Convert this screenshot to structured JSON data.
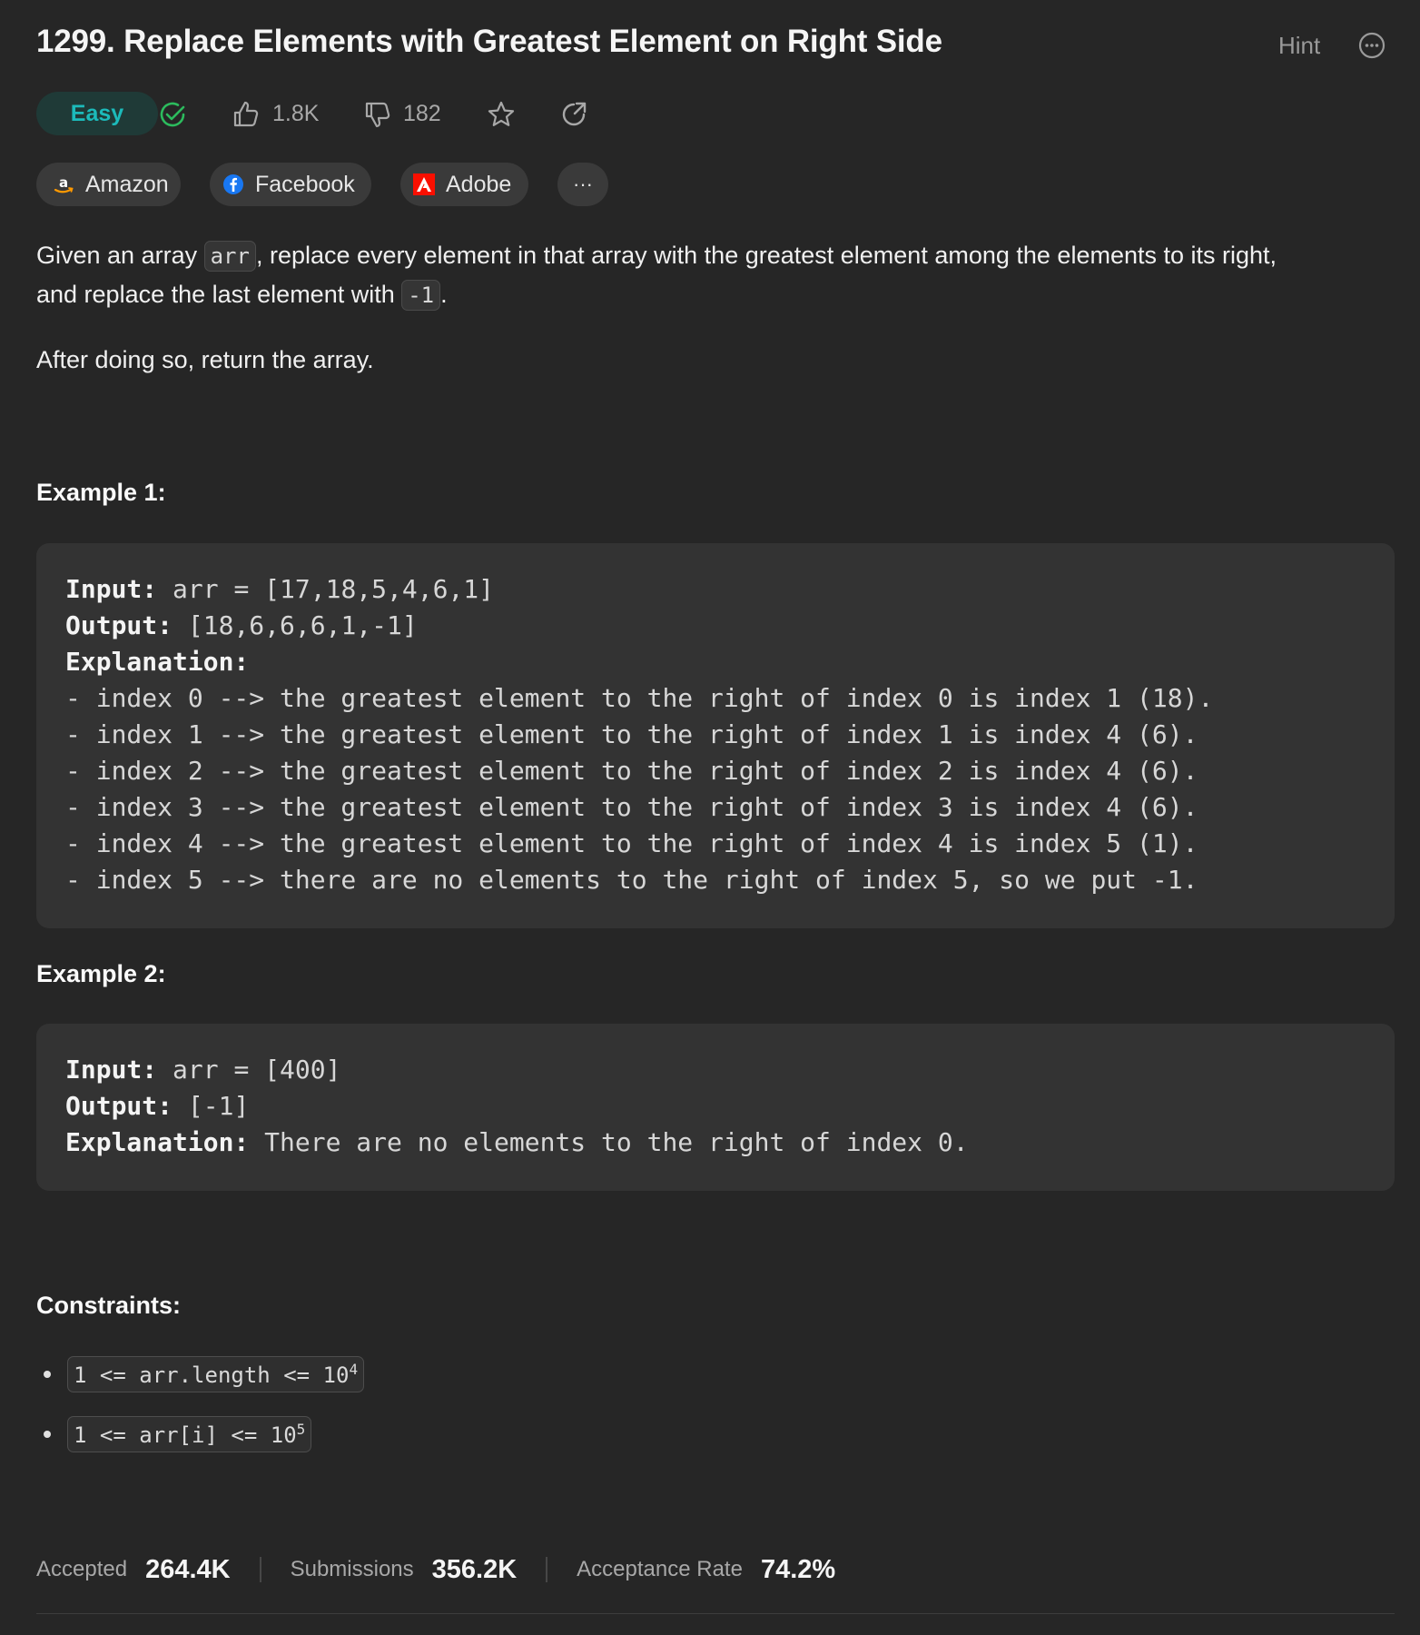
{
  "problem": {
    "title": "1299. Replace Elements with Greatest Element on Right Side",
    "hint_label": "Hint",
    "difficulty": "Easy",
    "likes": "1.8K",
    "dislikes": "182"
  },
  "tags": [
    {
      "label": "Amazon",
      "icon": "amazon-icon"
    },
    {
      "label": "Facebook",
      "icon": "facebook-icon"
    },
    {
      "label": "Adobe",
      "icon": "adobe-icon"
    }
  ],
  "more_tags_label": "···",
  "description": {
    "p1_a": "Given an array ",
    "p1_code1": "arr",
    "p1_b": ", replace every element in that array with the greatest element among the elements to its right,",
    "p1_c": "and replace the last element with ",
    "p1_code2": "-1",
    "p1_d": ".",
    "p2": "After doing so, return the array."
  },
  "examples": [
    {
      "heading": "Example 1:",
      "input_label": "Input:",
      "input": " arr = [17,18,5,4,6,1]",
      "output_label": "Output:",
      "output": " [18,6,6,6,1,-1]",
      "explanation_label": "Explanation:",
      "explanation_lines": [
        "- index 0 --> the greatest element to the right of index 0 is index 1 (18).",
        "- index 1 --> the greatest element to the right of index 1 is index 4 (6).",
        "- index 2 --> the greatest element to the right of index 2 is index 4 (6).",
        "- index 3 --> the greatest element to the right of index 3 is index 4 (6).",
        "- index 4 --> the greatest element to the right of index 4 is index 5 (1).",
        "- index 5 --> there are no elements to the right of index 5, so we put -1."
      ]
    },
    {
      "heading": "Example 2:",
      "input_label": "Input:",
      "input": " arr = [400]",
      "output_label": "Output:",
      "output": " [-1]",
      "explanation_label": "Explanation:",
      "explanation": " There are no elements to the right of index 0."
    }
  ],
  "constraints": {
    "heading": "Constraints:",
    "items": [
      {
        "text": "1 <= arr.length <= 10",
        "sup": "4"
      },
      {
        "text": "1 <= arr[i] <= 10",
        "sup": "5"
      }
    ]
  },
  "stats": {
    "accepted_label": "Accepted",
    "accepted": "264.4K",
    "submissions_label": "Submissions",
    "submissions": "356.2K",
    "rate_label": "Acceptance Rate",
    "rate": "74.2%"
  },
  "colors": {
    "background": "#262626",
    "easy_text": "#1cbaba",
    "solved_check": "#2cbb5d",
    "code_bg": "#333333"
  }
}
